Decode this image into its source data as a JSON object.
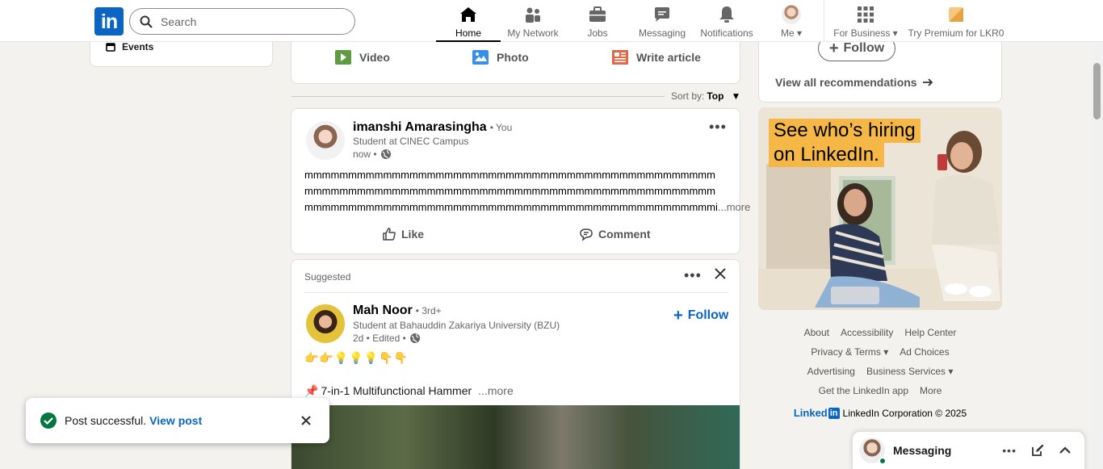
{
  "nav": {
    "search_placeholder": "Search",
    "items": [
      {
        "label": "Home",
        "icon": "home-icon"
      },
      {
        "label": "My Network",
        "icon": "network-icon"
      },
      {
        "label": "Jobs",
        "icon": "briefcase-icon"
      },
      {
        "label": "Messaging",
        "icon": "messaging-icon"
      },
      {
        "label": "Notifications",
        "icon": "bell-icon"
      },
      {
        "label": "Me",
        "icon": "avatar"
      }
    ],
    "business_label": "For Business",
    "premium_label": "Try Premium for LKR0",
    "logo_text": "in"
  },
  "left": {
    "events_label": "Events"
  },
  "composer": {
    "video": "Video",
    "photo": "Photo",
    "article": "Write article"
  },
  "sort": {
    "prefix": "Sort by:",
    "value": "Top"
  },
  "post1": {
    "author": "imanshi Amarasingha",
    "degree": "• You",
    "headline": "Student at CINEC Campus",
    "time": "now •",
    "lines": [
      "mmmmmmmmmmmmmmmmmmmmmmmmmmmmmmmmmmmmmmmmmmmmmmm",
      "mmmmmmmmmmmmmmmmmmmmmmmmmmmmmmmmmmmmmmmmmmmmmmm",
      "mmmmmmmmmmmmmmmmmmmmmmmmmmmmmmmmmmmmmmmmmmmmmmmi"
    ],
    "more": "...more",
    "like": "Like",
    "comment": "Comment"
  },
  "post2": {
    "suggested": "Suggested",
    "author": "Mah Noor",
    "degree": "• 3rd+",
    "headline": "Student at Bahauddin Zakariya University (BZU)",
    "time": "2d • Edited •",
    "follow": "Follow",
    "emojis": "👉👉💡💡💡👇👇",
    "pin": "📌",
    "title": "7-in-1 Multifunctional Hammer",
    "more": "...more"
  },
  "right": {
    "follow": "Follow",
    "view_all": "View all recommendations",
    "ad_line1": "See who’s hiring",
    "ad_line2": "on LinkedIn."
  },
  "footer": {
    "row1": [
      "About",
      "Accessibility",
      "Help Center"
    ],
    "row2": [
      "Privacy & Terms",
      "Ad Choices"
    ],
    "row3": [
      "Advertising",
      "Business Services"
    ],
    "row4": [
      "Get the LinkedIn app",
      "More"
    ],
    "brand": "Linked",
    "copyright": "LinkedIn Corporation © 2025"
  },
  "messaging": {
    "label": "Messaging"
  },
  "toast": {
    "text": "Post successful.",
    "link": "View post"
  },
  "colors": {
    "brand": "#0a66c2",
    "success": "#057642",
    "bg": "#f4f2ee",
    "premium": "#f8c77e"
  }
}
